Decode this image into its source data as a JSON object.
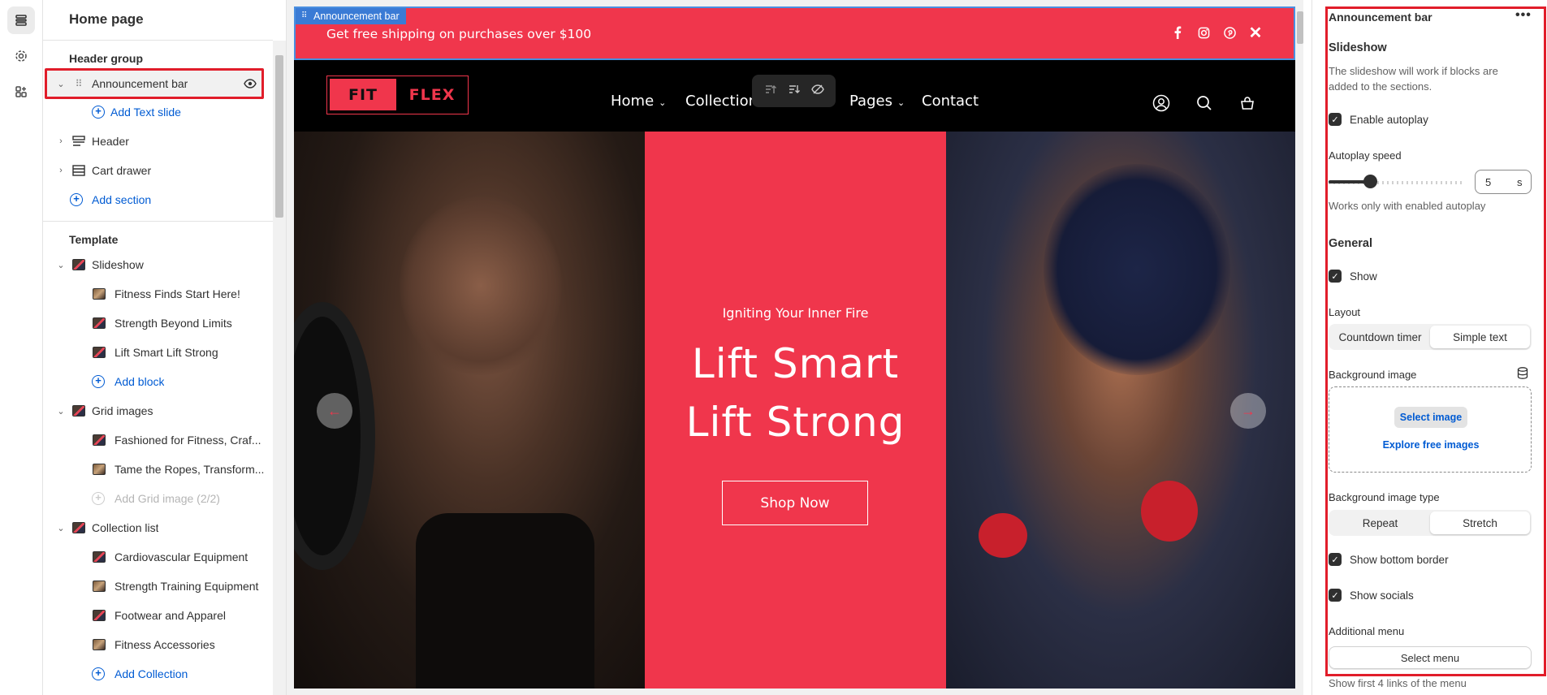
{
  "sidebar": {
    "title": "Home page",
    "header_group": {
      "label": "Header group",
      "items": [
        {
          "label": "Announcement bar"
        },
        {
          "label": "Add Text slide"
        },
        {
          "label": "Header"
        },
        {
          "label": "Cart drawer"
        }
      ],
      "add_label": "Add section"
    },
    "template": {
      "label": "Template",
      "slideshow": {
        "label": "Slideshow",
        "blocks": [
          "Fitness Finds Start Here!",
          "Strength Beyond Limits",
          "Lift Smart Lift Strong"
        ],
        "add_label": "Add block"
      },
      "grid_images": {
        "label": "Grid images",
        "blocks": [
          "Fashioned for Fitness, Craf...",
          "Tame the Ropes, Transform..."
        ],
        "add_label": "Add Grid image (2/2)"
      },
      "collection_list": {
        "label": "Collection list",
        "blocks": [
          "Cardiovascular Equipment",
          "Strength Training Equipment",
          "Footwear and Apparel",
          "Fitness Accessories"
        ],
        "add_label": "Add Collection"
      }
    }
  },
  "preview": {
    "tag": "Announcement bar",
    "announcement": "Get free shipping on purchases over $100",
    "logo": {
      "left": "FIT",
      "right": "FLEX"
    },
    "nav": [
      {
        "label": "Home"
      },
      {
        "label": "Collections"
      },
      {
        "label": "Pages"
      },
      {
        "label": "Contact"
      }
    ],
    "hero": {
      "subtitle": "Igniting Your Inner Fire",
      "title_line1": "Lift Smart",
      "title_line2": "Lift Strong",
      "button": "Shop Now"
    },
    "colors": {
      "accent": "#f0364c",
      "selection": "#e11d2a",
      "link": "#005bd3"
    }
  },
  "panel": {
    "title": "Announcement bar",
    "slideshow_heading": "Slideshow",
    "slideshow_help": "The slideshow will work if blocks are added to the sections.",
    "enable_autoplay": "Enable autoplay",
    "autoplay_speed_label": "Autoplay speed",
    "autoplay_speed_value": "5",
    "autoplay_speed_unit": "s",
    "autoplay_help": "Works only with enabled autoplay",
    "general_heading": "General",
    "show": "Show",
    "layout_label": "Layout",
    "layout_options": [
      "Countdown timer",
      "Simple text"
    ],
    "bg_image_label": "Background image",
    "select_image": "Select image",
    "explore_images": "Explore free images",
    "bg_type_label": "Background image type",
    "bg_type_options": [
      "Repeat",
      "Stretch"
    ],
    "show_bottom_border": "Show bottom border",
    "show_socials": "Show socials",
    "additional_menu_label": "Additional menu",
    "select_menu": "Select menu",
    "menu_help": "Show first 4 links of the menu"
  }
}
